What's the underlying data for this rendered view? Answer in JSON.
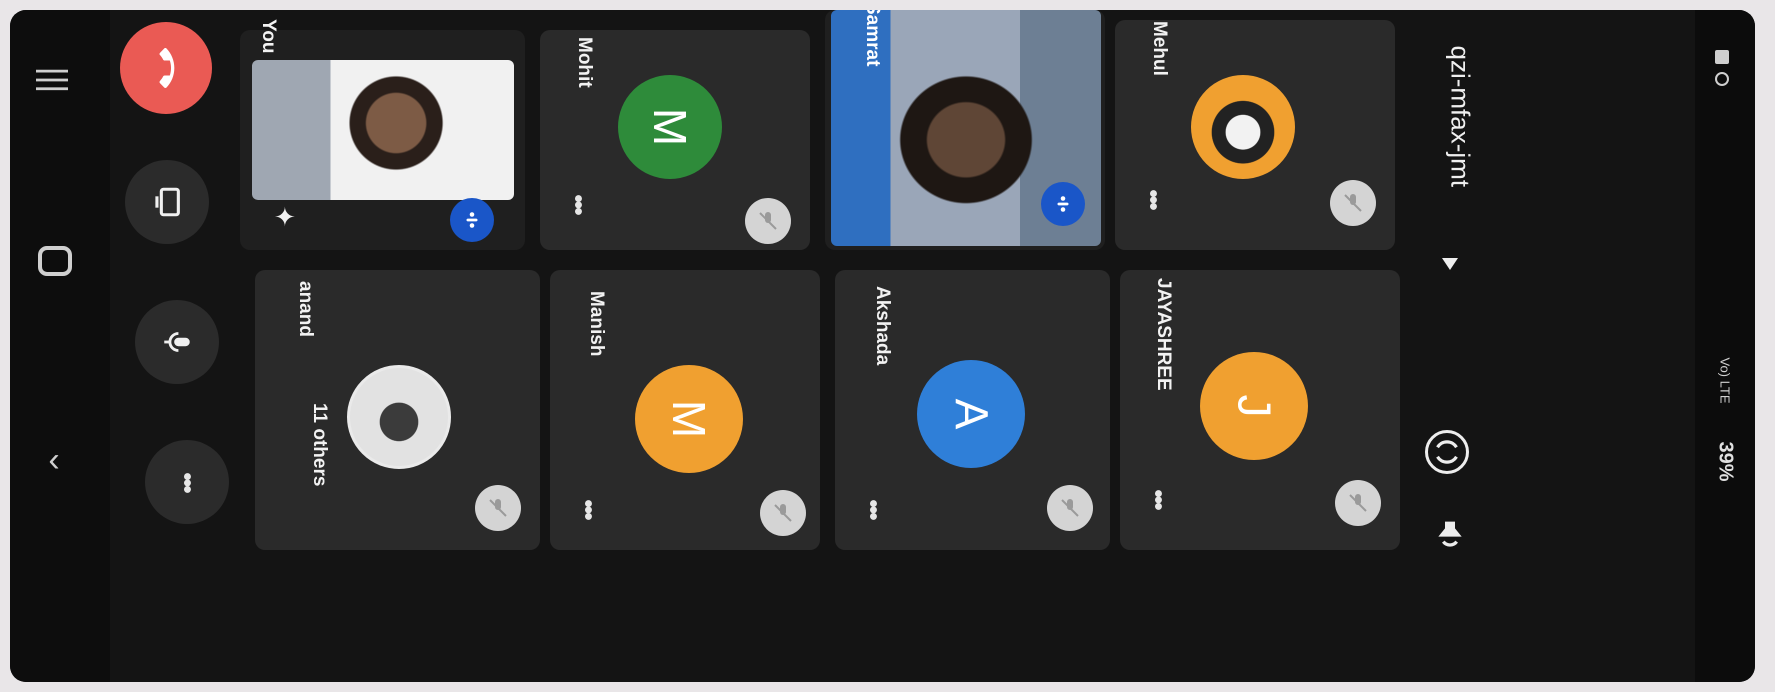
{
  "meeting": {
    "name": "qzi-mfax-jmt",
    "dropdown_icon": "caret-down-icon"
  },
  "status_bar": {
    "battery": "39%",
    "network": "Vo) LTE"
  },
  "controls": {
    "end_call_icon": "phone-hangup-icon",
    "present_icon": "present-screen-icon",
    "mic_icon": "microphone-icon",
    "more_icon": "more-options-icon",
    "flip_camera_icon": "camera-flip-icon",
    "speaker_icon": "speaker-icon"
  },
  "participants": [
    {
      "name": "You",
      "type": "video",
      "status": "speaking"
    },
    {
      "name": "Mohit",
      "type": "avatar",
      "initial": "M",
      "color": "#2e8b3a",
      "status": "muted"
    },
    {
      "name": "Samrat",
      "type": "video",
      "status": "speaking"
    },
    {
      "name": "Mehul",
      "type": "photo",
      "status": "muted"
    },
    {
      "name": "anand",
      "type": "photo",
      "status": "muted",
      "others": "11 others"
    },
    {
      "name": "Manish",
      "type": "avatar",
      "initial": "M",
      "color": "#f0a030",
      "status": "muted"
    },
    {
      "name": "Akshada",
      "type": "avatar",
      "initial": "A",
      "color": "#2f7fd8",
      "status": "muted"
    },
    {
      "name": "JAYASHREE",
      "type": "avatar",
      "initial": "J",
      "color": "#f0a030",
      "status": "muted"
    }
  ],
  "more_label": "•••",
  "colors": {
    "end_call": "#ea5a54",
    "speaking_badge": "#1a56c8",
    "tile": "#2a2a2a"
  }
}
